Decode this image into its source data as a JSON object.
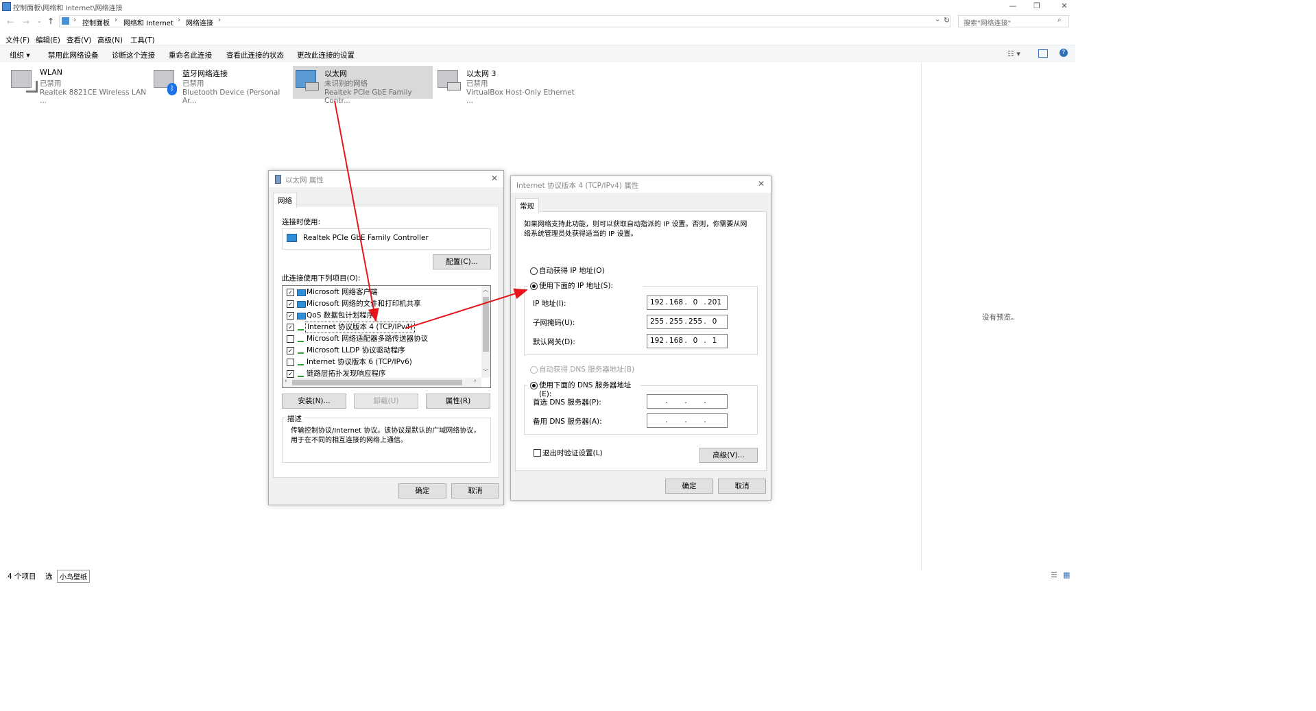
{
  "window": {
    "title": "控制面板\\网络和 Internet\\网络连接"
  },
  "address": {
    "crumbs": [
      "控制面板",
      "网络和 Internet",
      "网络连接"
    ],
    "search_placeholder": "搜索\"网络连接\""
  },
  "menubar": [
    "文件(F)",
    "编辑(E)",
    "查看(V)",
    "高级(N)",
    "工具(T)"
  ],
  "commandbar": [
    "组织 ▾",
    "禁用此网络设备",
    "诊断这个连接",
    "重命名此连接",
    "查看此连接的状态",
    "更改此连接的设置"
  ],
  "adapters": [
    {
      "name": "WLAN",
      "status": "已禁用",
      "device": "Realtek 8821CE Wireless LAN ..."
    },
    {
      "name": "蓝牙网络连接",
      "status": "已禁用",
      "device": "Bluetooth Device (Personal Ar..."
    },
    {
      "name": "以太网",
      "status": "未识别的网络",
      "device": "Realtek PCIe GbE Family Contr..."
    },
    {
      "name": "以太网 3",
      "status": "已禁用",
      "device": "VirtualBox Host-Only Ethernet ..."
    }
  ],
  "preview_text": "没有预览。",
  "statusbar": {
    "count": "4 个项目",
    "selected": "选",
    "watermark": "小鸟壁纸"
  },
  "props_dialog": {
    "title": "以太网 属性",
    "tab": "网络",
    "connect_using_label": "连接时使用:",
    "adapter_name": "Realtek PCIe GbE Family Controller",
    "configure_button": "配置(C)...",
    "items_label": "此连接使用下列项目(O):",
    "items": [
      {
        "checked": true,
        "label": "Microsoft 网络客户端",
        "icon": "network-client-icon"
      },
      {
        "checked": true,
        "label": "Microsoft 网络的文件和打印机共享",
        "icon": "network-client-icon"
      },
      {
        "checked": true,
        "label": "QoS 数据包计划程序",
        "icon": "network-client-icon"
      },
      {
        "checked": true,
        "label": "Internet 协议版本 4 (TCP/IPv4)",
        "icon": "protocol-icon"
      },
      {
        "checked": false,
        "label": "Microsoft 网络适配器多路传送器协议",
        "icon": "protocol-icon"
      },
      {
        "checked": true,
        "label": "Microsoft LLDP 协议驱动程序",
        "icon": "protocol-icon"
      },
      {
        "checked": false,
        "label": "Internet 协议版本 6 (TCP/IPv6)",
        "icon": "protocol-icon"
      },
      {
        "checked": true,
        "label": "链路层拓扑发现响应程序",
        "icon": "protocol-icon"
      }
    ],
    "install_button": "安装(N)...",
    "uninstall_button": "卸载(U)",
    "properties_button": "属性(R)",
    "description_label": "描述",
    "description_text": "传输控制协议/Internet 协议。该协议是默认的广域网络协议，用于在不同的相互连接的网络上通信。",
    "ok_button": "确定",
    "cancel_button": "取消"
  },
  "ipv4_dialog": {
    "title": "Internet 协议版本 4 (TCP/IPv4) 属性",
    "tab": "常规",
    "intro": "如果网络支持此功能，则可以获取自动指派的 IP 设置。否则，你需要从网络系统管理员处获得适当的 IP 设置。",
    "auto_ip_label": "自动获得 IP 地址(O)",
    "manual_ip_label": "使用下面的 IP 地址(S):",
    "ip_label": "IP 地址(I):",
    "ip": [
      "192",
      "168",
      "0",
      "201"
    ],
    "mask_label": "子网掩码(U):",
    "mask": [
      "255",
      "255",
      "255",
      "0"
    ],
    "gateway_label": "默认网关(D):",
    "gateway": [
      "192",
      "168",
      "0",
      "1"
    ],
    "auto_dns_label": "自动获得 DNS 服务器地址(B)",
    "manual_dns_label": "使用下面的 DNS 服务器地址(E):",
    "dns1_label": "首选 DNS 服务器(P):",
    "dns2_label": "备用 DNS 服务器(A):",
    "dns1": [
      "",
      "",
      "",
      ""
    ],
    "dns2": [
      "",
      "",
      "",
      ""
    ],
    "validate_label": "退出时验证设置(L)",
    "advanced_button": "高级(V)...",
    "ok_button": "确定",
    "cancel_button": "取消"
  },
  "colors": {
    "selection": "#cce8ff",
    "selected_tile": "#d9d9d9",
    "arrow": "#e8141c",
    "dialog_bg": "#f0f0f0"
  }
}
